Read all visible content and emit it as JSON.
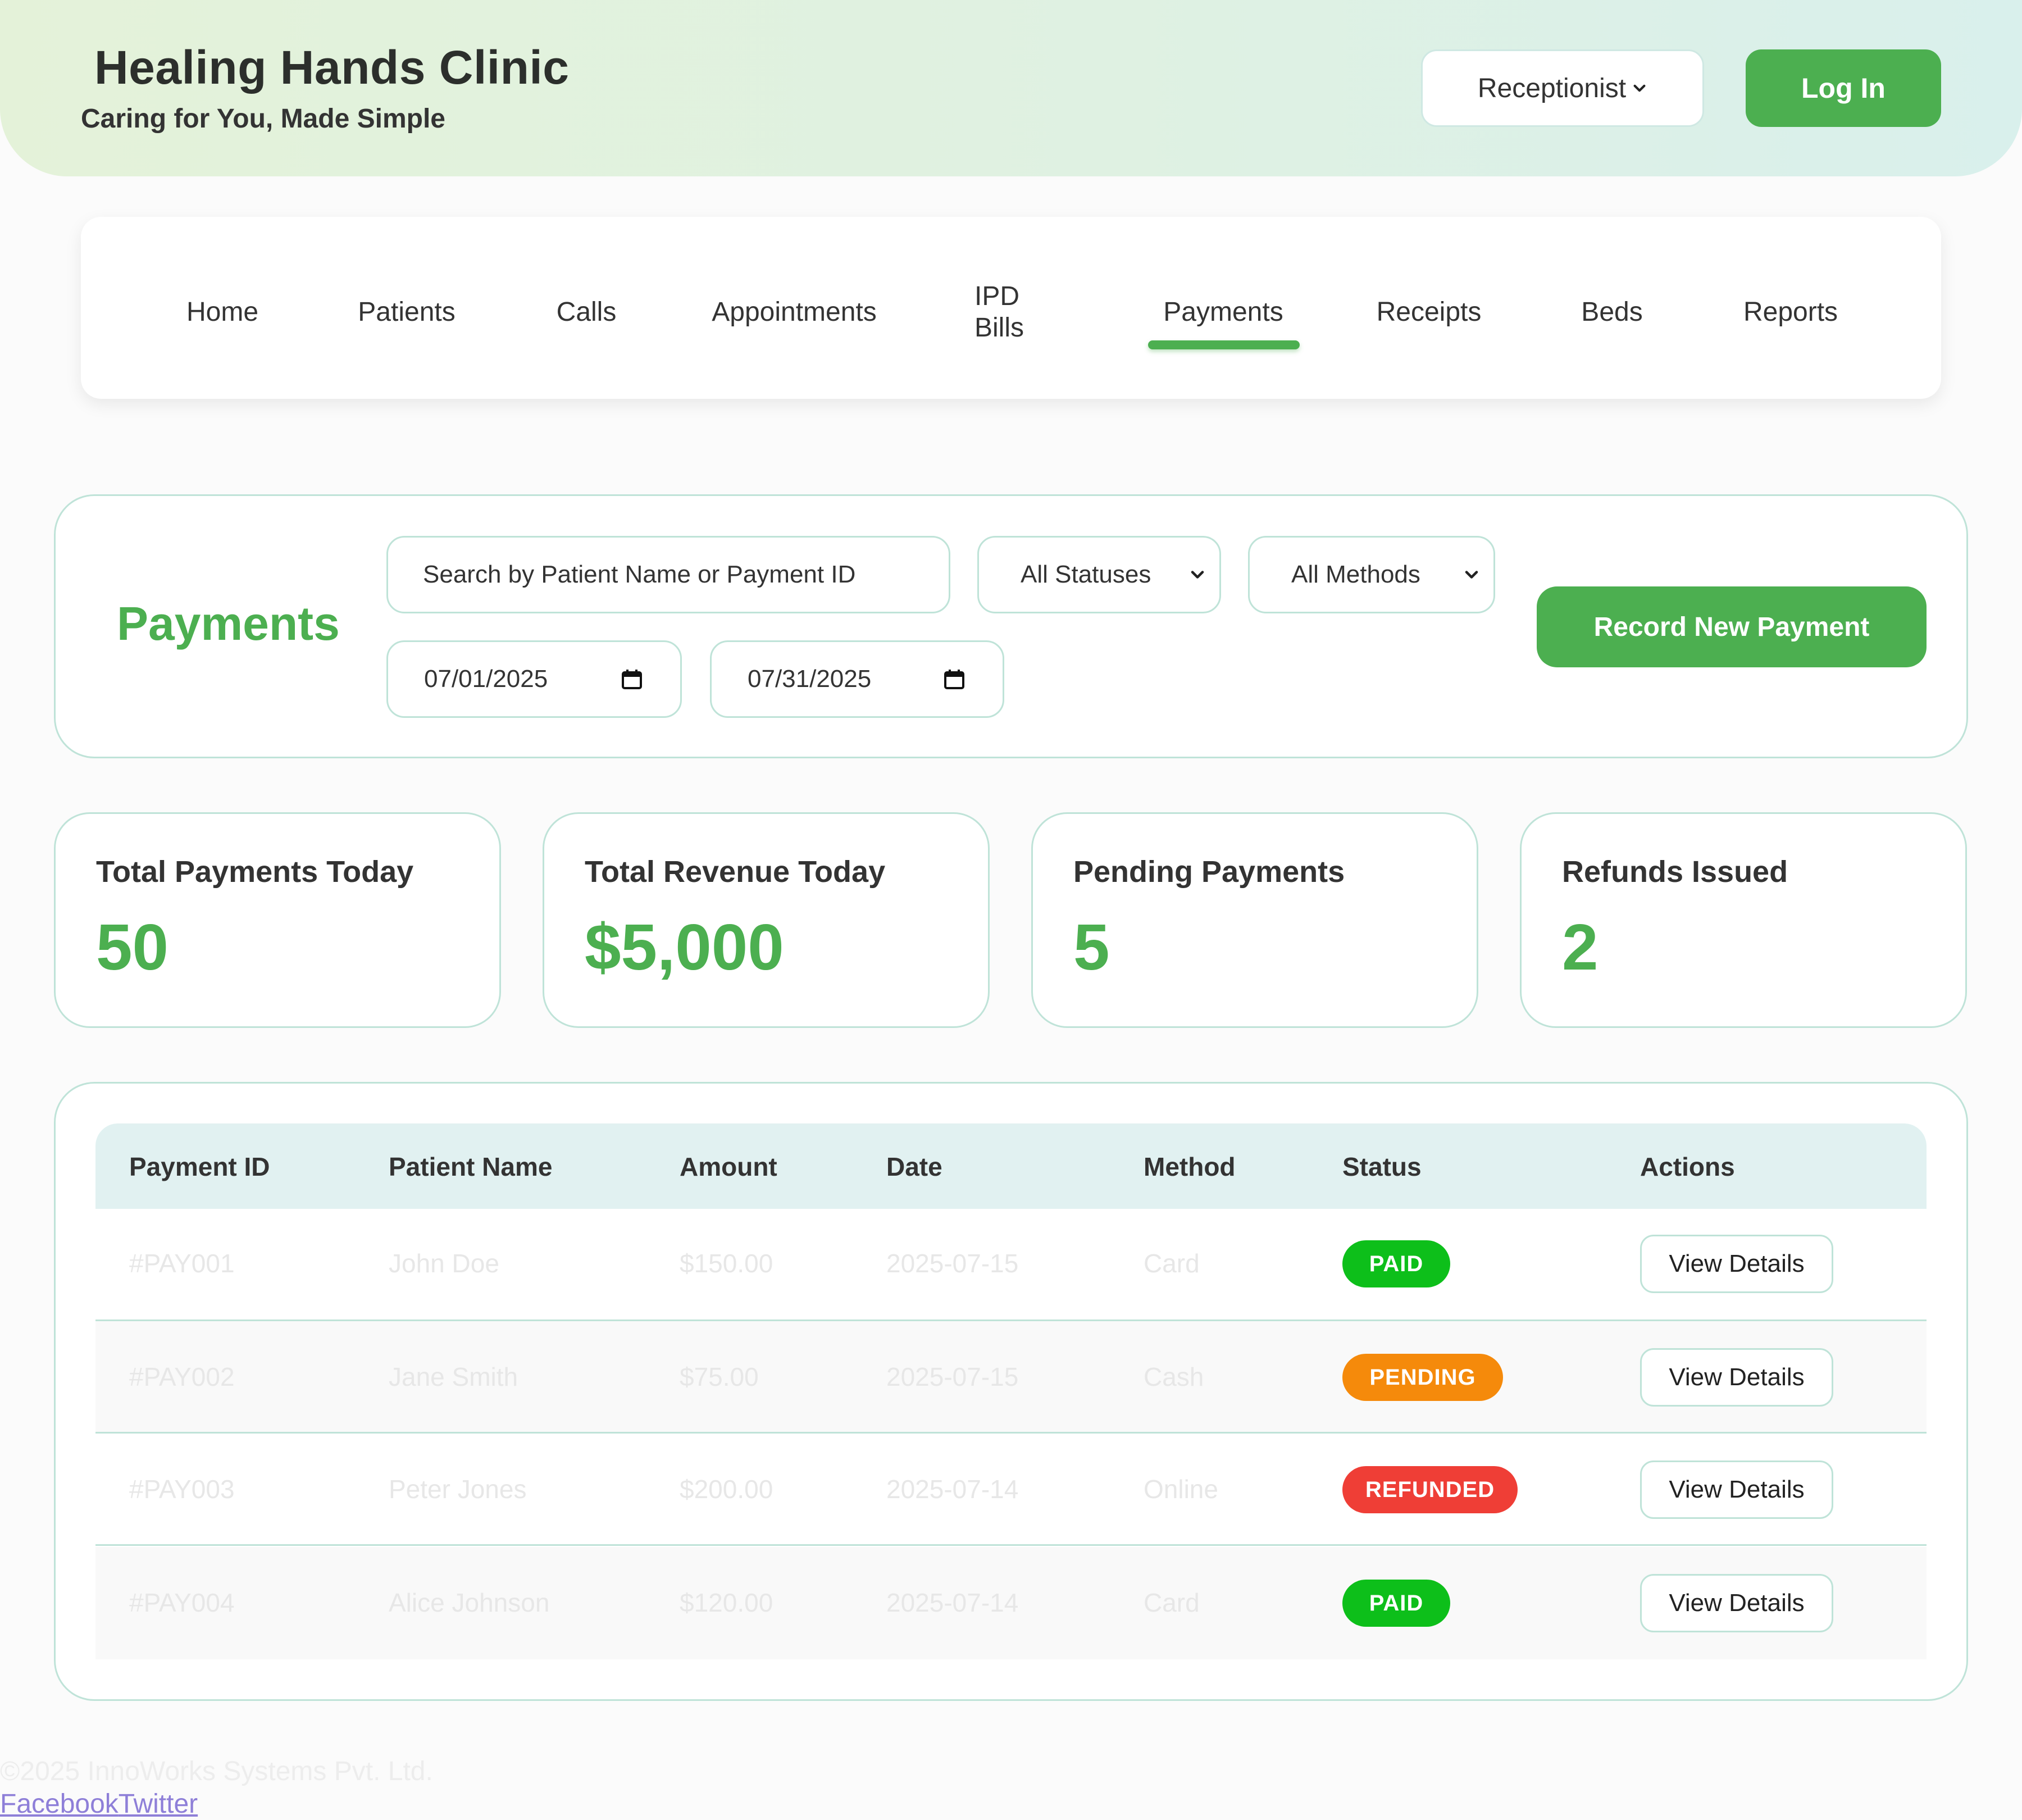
{
  "header": {
    "title": "Healing Hands Clinic",
    "tagline": "Caring for You, Made Simple",
    "role": "Receptionist",
    "login_label": "Log In"
  },
  "nav": {
    "items": [
      {
        "label": "Home"
      },
      {
        "label": "Patients"
      },
      {
        "label": "Calls"
      },
      {
        "label": "Appointments"
      },
      {
        "label": "IPD Bills"
      },
      {
        "label": "Payments",
        "active": true
      },
      {
        "label": "Receipts"
      },
      {
        "label": "Beds"
      },
      {
        "label": "Reports"
      }
    ]
  },
  "filters": {
    "title": "Payments",
    "search_placeholder": "Search by Patient Name or Payment ID",
    "status_selected": "All Statuses",
    "method_selected": "All Methods",
    "date_from": "07/01/2025",
    "date_to": "07/31/2025",
    "record_label": "Record New Payment"
  },
  "stats": [
    {
      "label": "Total Payments Today",
      "value": "50"
    },
    {
      "label": "Total Revenue Today",
      "value": "$5,000"
    },
    {
      "label": "Pending Payments",
      "value": "5"
    },
    {
      "label": "Refunds Issued",
      "value": "2"
    }
  ],
  "table": {
    "headers": [
      "Payment ID",
      "Patient Name",
      "Amount",
      "Date",
      "Method",
      "Status",
      "Actions"
    ],
    "rows": [
      {
        "id": "#PAY001",
        "patient": "John Doe",
        "amount": "$150.00",
        "date": "2025-07-15",
        "method": "Card",
        "status": "PAID",
        "action": "View Details"
      },
      {
        "id": "#PAY002",
        "patient": "Jane Smith",
        "amount": "$75.00",
        "date": "2025-07-15",
        "method": "Cash",
        "status": "PENDING",
        "action": "View Details"
      },
      {
        "id": "#PAY003",
        "patient": "Peter Jones",
        "amount": "$200.00",
        "date": "2025-07-14",
        "method": "Online",
        "status": "REFUNDED",
        "action": "View Details"
      },
      {
        "id": "#PAY004",
        "patient": "Alice Johnson",
        "amount": "$120.00",
        "date": "2025-07-14",
        "method": "Card",
        "status": "PAID",
        "action": "View Details"
      }
    ]
  },
  "colors": {
    "accent": "#4caf50",
    "paid": "#0dbf1a",
    "pending": "#f58a0b",
    "refunded": "#ef3e36"
  },
  "footer": {
    "copyright": "©2025 InnoWorks Systems Pvt. Ltd.",
    "links": [
      "Facebook",
      "Twitter"
    ]
  }
}
